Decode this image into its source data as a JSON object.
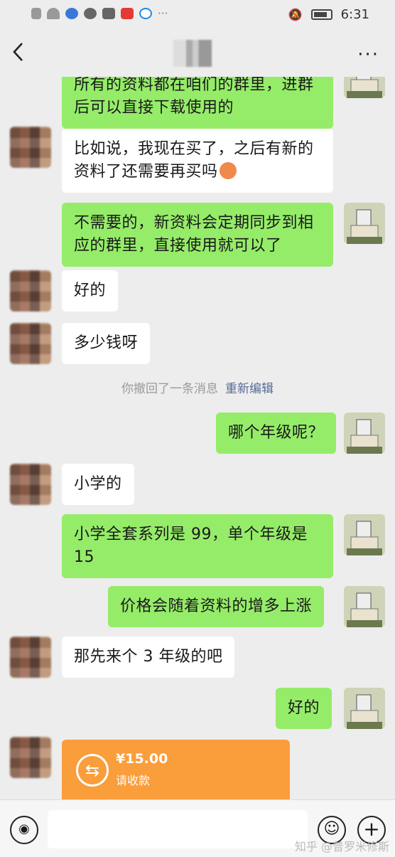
{
  "status_bar": {
    "time": "6:31"
  },
  "navbar": {
    "back_icon": "chevron-left-icon",
    "more_icon": "more-dots-icon",
    "more_label": "···"
  },
  "messages": [
    {
      "side": "me",
      "text": "所有的资料都在咱们的群里，进群\n后可以直接下载使用的"
    },
    {
      "side": "them",
      "text": "比如说，我现在买了，之后有新的\n资料了还需要再买吗"
    },
    {
      "side": "me",
      "text": "不需要的，新资料会定期同步到相\n应的群里，直接使用就可以了"
    },
    {
      "side": "them",
      "text": "好的"
    },
    {
      "side": "them",
      "text": "多少钱呀"
    },
    {
      "side": "me",
      "text": "哪个年级呢？"
    },
    {
      "side": "them",
      "text": "小学的"
    },
    {
      "side": "me",
      "text": "小学全套系列是 99，单个年级是\n15"
    },
    {
      "side": "me",
      "text": "价格会随着资料的增多上涨"
    },
    {
      "side": "them",
      "text": "那先来个 3 年级的吧"
    },
    {
      "side": "me",
      "text": "好的"
    }
  ],
  "system_notice": {
    "text": "你撤回了一条消息",
    "action": "重新编辑"
  },
  "transfer": {
    "amount": "¥15.00",
    "note": "请收款",
    "icon": "transfer-arrows-icon"
  },
  "bottom_bar": {
    "voice_icon": "voice-icon",
    "emoji_icon": "emoji-icon",
    "plus_icon": "plus-icon"
  },
  "watermark": "知乎 @普罗米修斯",
  "colors": {
    "my_bubble": "#95ec69",
    "their_bubble": "#ffffff",
    "transfer": "#fa9d3b",
    "link": "#576b95"
  }
}
